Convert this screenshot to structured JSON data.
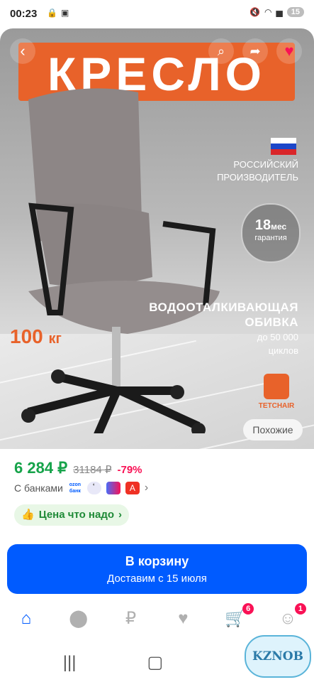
{
  "status_bar": {
    "time": "00:23",
    "battery": "15",
    "left_icons": [
      "lock-icon",
      "screen-record-icon"
    ],
    "right_icons": [
      "mute-icon",
      "wifi-icon",
      "signal-icon"
    ]
  },
  "product_image": {
    "banner_text": "КРЕСЛО",
    "maker_text": [
      "РОССИЙСКИЙ",
      "ПРОИЗВОДИТЕЛЬ"
    ],
    "warranty": {
      "value": "18",
      "unit": "мес",
      "label": "гарантия"
    },
    "fabric": {
      "title": [
        "ВОДООТАЛКИВАЮЩАЯ",
        "ОБИВКА"
      ],
      "cycles": [
        "до 50 000",
        "циклов"
      ]
    },
    "max_weight": {
      "value": "100",
      "unit": "кг"
    },
    "brand": "TETCHAIR",
    "similar_button": "Похожие",
    "accent_color": "#e8622a"
  },
  "pricing": {
    "price": "6 284 ₽",
    "old_price": "31184 ₽",
    "discount": "-79%",
    "banks_label": "С банками",
    "bank_icons": [
      "ozon-bank-icon",
      "sber-icon",
      "bank-pink-icon",
      "alfa-icon"
    ],
    "bank_logo_text": [
      "ozon",
      "банк"
    ],
    "good_price_label": "Цена что надо",
    "price_color": "#16a34a"
  },
  "cart_button": {
    "title": "В корзину",
    "subtitle": "Доставим с 15 июля",
    "color": "#005bff"
  },
  "bottom_nav": {
    "items": [
      {
        "name": "home",
        "icon": "home-icon",
        "active": true
      },
      {
        "name": "fresh",
        "icon": "apple-icon"
      },
      {
        "name": "finance",
        "icon": "ruble-icon"
      },
      {
        "name": "favorites",
        "icon": "heart-icon"
      },
      {
        "name": "cart",
        "icon": "basket-icon",
        "badge": "6"
      },
      {
        "name": "profile",
        "icon": "profile-icon",
        "badge": "1"
      }
    ]
  },
  "watermark": "KZNOB"
}
